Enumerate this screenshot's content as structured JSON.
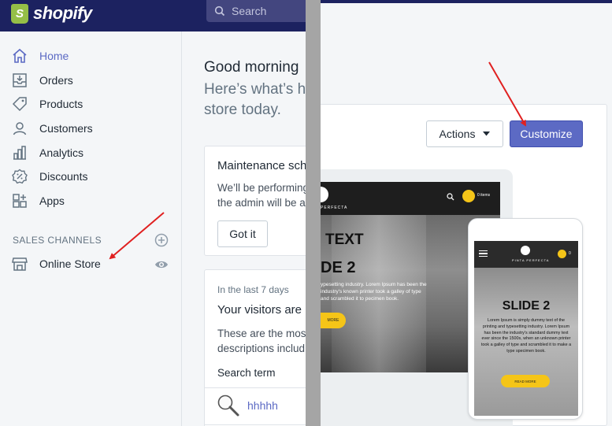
{
  "brand": {
    "name": "shopify",
    "mark": "S"
  },
  "search": {
    "placeholder": "Search"
  },
  "nav": {
    "items": [
      {
        "label": "Home",
        "icon": "home-icon"
      },
      {
        "label": "Orders",
        "icon": "orders-icon"
      },
      {
        "label": "Products",
        "icon": "tag-icon"
      },
      {
        "label": "Customers",
        "icon": "customers-icon"
      },
      {
        "label": "Analytics",
        "icon": "analytics-icon"
      },
      {
        "label": "Discounts",
        "icon": "discount-icon"
      },
      {
        "label": "Apps",
        "icon": "apps-icon"
      }
    ],
    "active": "Home",
    "sales_channels_title": "SALES CHANNELS",
    "online_store": "Online Store"
  },
  "home": {
    "greeting": "Good morning",
    "sub_line1": "Here’s what’s h",
    "sub_line2": "store today."
  },
  "maintenance": {
    "title": "Maintenance sch",
    "text_line1": "We’ll be performing",
    "text_line2": "the admin will be a",
    "button": "Got it"
  },
  "visitors": {
    "period": "In the last 7 days",
    "title": "Your visitors are",
    "text_line1": "These are the most",
    "text_line2": "descriptions includ",
    "column": "Search term",
    "term": "hhhhh"
  },
  "theme": {
    "actions_label": "Actions",
    "customize_label": "Customize",
    "desktop": {
      "brand": "PERFECTA",
      "cart_count": "0 items",
      "slide_title": "DE 2",
      "lorem": "ypesetting industry. Lorem Ipsum has been the industry's known printer took a galley of type and scrambled it to pecimen book.",
      "more": "MORE",
      "text": "TEXT"
    },
    "mobile": {
      "brand": "PINTA PERFECTA",
      "cart_count": "0",
      "slide_title": "SLIDE 2",
      "lorem": "Lorem Ipsum is simply dummy text of the printing and typesetting industry. Lorem Ipsum has been the industry's standard dummy text ever since the 1500s, when an unknown printer took a galley of type and scrambled it to make a type specimen book.",
      "more": "READ MORE"
    }
  },
  "colors": {
    "topbar": "#1c2260",
    "accent": "#5c6ac4",
    "arrow": "#e02020",
    "shopify_green": "#95bf47",
    "cta_yellow": "#f5c518"
  }
}
